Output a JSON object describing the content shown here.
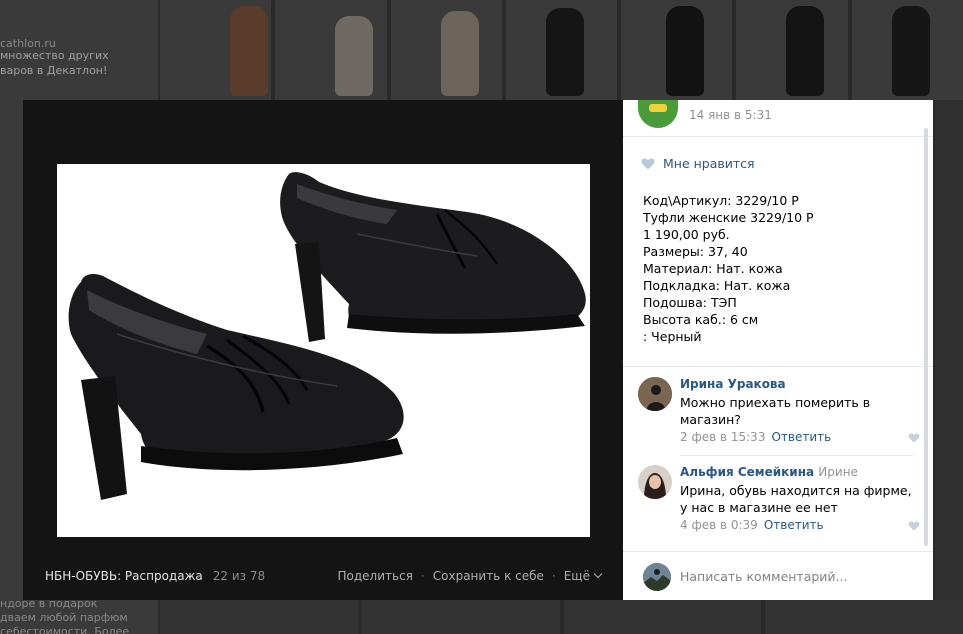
{
  "background": {
    "left_texts": [
      "множество других",
      "варов в Декатлон!",
      "cathlon.ru",
      "ндоре в подарок",
      "дваем любой парфюм",
      "себестоимости. Более"
    ]
  },
  "viewer": {
    "album_title": "НБН-ОБУВЬ: Распродажа",
    "photo_counter": "22 из 78",
    "actions": {
      "share": "Поделиться",
      "save": "Сохранить к себе",
      "more": "Ещё",
      "separator": "·"
    }
  },
  "panel": {
    "post_date": "14 янв в 5:31",
    "like_label": "Мне нравится",
    "description": [
      "Код\\Артикул: 3229/10 Р",
      "Туфли женские 3229/10 Р",
      "1 190,00 руб.",
      "Размеры: 37, 40",
      "Материал: Нат. кожа",
      "Подкладка: Нат. кожа",
      "Подошва: ТЭП",
      "Высота каб.: 6 см",
      ": Черный"
    ],
    "comments": [
      {
        "author": "Ирина Уракова",
        "reply_to": "",
        "text": "Можно приехать померить в магазин?",
        "date": "2 фев в 15:33",
        "reply_label": "Ответить"
      },
      {
        "author": "Альфия Семейкина",
        "reply_to": "Ирине",
        "text": "Ирина, обувь находится на фирме, у нас в магазине ее нет",
        "date": "4 фев в 0:39",
        "reply_label": "Ответить"
      }
    ],
    "write_placeholder": "Написать комментарий..."
  },
  "colors": {
    "link": "#2a5885",
    "meta": "#939393",
    "viewer_bg": "#141414",
    "panel_bg": "#ffffff"
  }
}
